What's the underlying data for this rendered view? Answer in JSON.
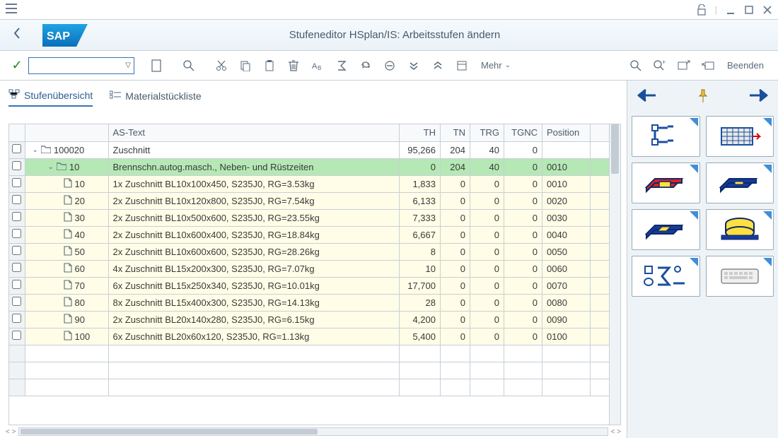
{
  "window": {
    "title": "Stufeneditor HSplan/IS: Arbeitsstufen ändern"
  },
  "toolbar": {
    "more_label": "Mehr",
    "exit_label": "Beenden"
  },
  "tabs": {
    "overview": "Stufenübersicht",
    "bom": "Materialstückliste"
  },
  "table": {
    "headers": {
      "astext": "AS-Text",
      "th": "TH",
      "tn": "TN",
      "trg": "TRG",
      "tgnc": "TGNC",
      "position": "Position"
    },
    "rows": [
      {
        "level": 0,
        "style": "white",
        "expand": true,
        "folder": true,
        "node": "100020",
        "text": "Zuschnitt",
        "th": "95,266",
        "tn": "204",
        "trg": "40",
        "tgnc": "0",
        "pos": ""
      },
      {
        "level": 1,
        "style": "green",
        "expand": true,
        "folder": true,
        "node": "10",
        "text": "Brennschn.autog.masch., Neben- und Rüstzeiten",
        "th": "0",
        "tn": "204",
        "trg": "40",
        "tgnc": "0",
        "pos": "0010"
      },
      {
        "level": 2,
        "style": "yellow",
        "expand": false,
        "folder": false,
        "node": "10",
        "text": "1x Zuschnitt BL10x100x450, S235J0, RG=3.53kg",
        "th": "1,833",
        "tn": "0",
        "trg": "0",
        "tgnc": "0",
        "pos": "0010"
      },
      {
        "level": 2,
        "style": "yellow",
        "expand": false,
        "folder": false,
        "node": "20",
        "text": "2x Zuschnitt BL10x120x800, S235J0, RG=7.54kg",
        "th": "6,133",
        "tn": "0",
        "trg": "0",
        "tgnc": "0",
        "pos": "0020"
      },
      {
        "level": 2,
        "style": "yellow",
        "expand": false,
        "folder": false,
        "node": "30",
        "text": "2x Zuschnitt BL10x500x600, S235J0, RG=23.55kg",
        "th": "7,333",
        "tn": "0",
        "trg": "0",
        "tgnc": "0",
        "pos": "0030"
      },
      {
        "level": 2,
        "style": "yellow",
        "expand": false,
        "folder": false,
        "node": "40",
        "text": "2x Zuschnitt BL10x600x400, S235J0, RG=18.84kg",
        "th": "6,667",
        "tn": "0",
        "trg": "0",
        "tgnc": "0",
        "pos": "0040"
      },
      {
        "level": 2,
        "style": "yellow",
        "expand": false,
        "folder": false,
        "node": "50",
        "text": "2x Zuschnitt BL10x600x600, S235J0, RG=28.26kg",
        "th": "8",
        "tn": "0",
        "trg": "0",
        "tgnc": "0",
        "pos": "0050"
      },
      {
        "level": 2,
        "style": "yellow",
        "expand": false,
        "folder": false,
        "node": "60",
        "text": "4x Zuschnitt BL15x200x300, S235J0, RG=7.07kg",
        "th": "10",
        "tn": "0",
        "trg": "0",
        "tgnc": "0",
        "pos": "0060"
      },
      {
        "level": 2,
        "style": "yellow",
        "expand": false,
        "folder": false,
        "node": "70",
        "text": "6x Zuschnitt BL15x250x340, S235J0, RG=10.01kg",
        "th": "17,700",
        "tn": "0",
        "trg": "0",
        "tgnc": "0",
        "pos": "0070"
      },
      {
        "level": 2,
        "style": "yellow",
        "expand": false,
        "folder": false,
        "node": "80",
        "text": "8x Zuschnitt BL15x400x300, S235J0, RG=14.13kg",
        "th": "28",
        "tn": "0",
        "trg": "0",
        "tgnc": "0",
        "pos": "0080"
      },
      {
        "level": 2,
        "style": "yellow",
        "expand": false,
        "folder": false,
        "node": "90",
        "text": "2x Zuschnitt BL20x140x280, S235J0, RG=6.15kg",
        "th": "4,200",
        "tn": "0",
        "trg": "0",
        "tgnc": "0",
        "pos": "0090"
      },
      {
        "level": 2,
        "style": "yellow",
        "expand": false,
        "folder": false,
        "node": "100",
        "text": "6x Zuschnitt BL20x60x120, S235J0, RG=1.13kg",
        "th": "5,400",
        "tn": "0",
        "trg": "0",
        "tgnc": "0",
        "pos": "0100"
      }
    ]
  }
}
